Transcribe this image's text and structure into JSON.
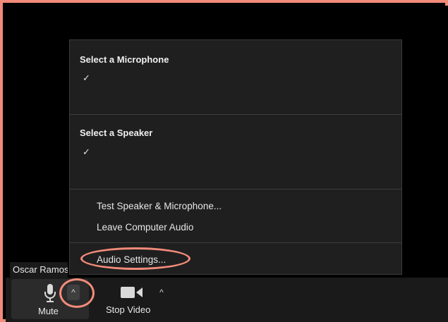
{
  "participant": {
    "name": "Oscar Ramos"
  },
  "audio_menu": {
    "microphone_heading": "Select a Microphone",
    "microphone_check": "✓",
    "speaker_heading": "Select a Speaker",
    "speaker_check": "✓",
    "items": [
      {
        "label": "Test Speaker & Microphone..."
      },
      {
        "label": "Leave Computer Audio"
      }
    ],
    "settings_label": "Audio Settings..."
  },
  "toolbar": {
    "mute_label": "Mute",
    "caret": "^",
    "stop_video_label": "Stop Video"
  },
  "colors": {
    "highlight": "#f28b7a",
    "menu_bg": "#1f1f1f",
    "toolbar_bg": "#1a1a1a"
  },
  "icons": {
    "mute": "microphone-icon",
    "video": "video-camera-icon",
    "caret": "caret-up-icon",
    "check": "checkmark-icon"
  }
}
